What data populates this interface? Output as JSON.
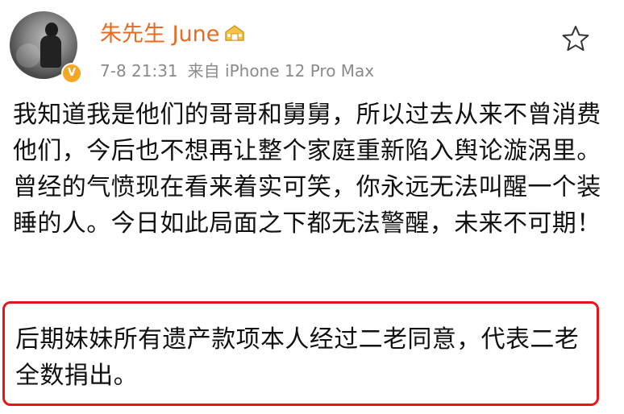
{
  "post": {
    "username": "朱先生 June",
    "date": "7-8 21:31",
    "source": "来自 iPhone 12 Pro Max",
    "body": "我知道我是他们的哥哥和舅舅，所以过去从来不曾消费他们，今后也不想再让整个家庭重新陷入舆论漩涡里。曾经的气愤现在看来着实可笑，你永远无法叫醒一个装睡的人。今日如此局面之下都无法警醒，未来不可期！",
    "highlighted": "后期妹妹所有遗产款项本人经过二老同意，代表二老全数捐出。"
  },
  "icons": {
    "avatar": "profile-photo",
    "verified": "verified-v-badge",
    "user_badge": "gold-house-badge-icon",
    "favorite": "star-outline-icon"
  },
  "colors": {
    "username": "#e86b1f",
    "meta": "#8a8a8a",
    "highlight_border": "#e8141b",
    "verified_badge": "#f5a623"
  }
}
